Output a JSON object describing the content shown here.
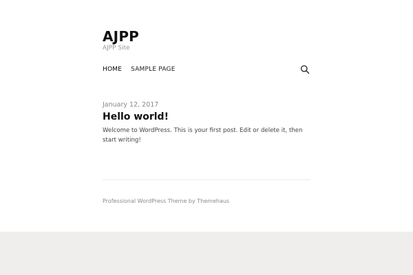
{
  "site": {
    "title": "AJPP",
    "description": "AJPP Site"
  },
  "nav": {
    "items": [
      {
        "label": "Home",
        "current": true
      },
      {
        "label": "Sample Page",
        "current": false
      }
    ],
    "search_icon": "search-icon"
  },
  "post": {
    "date": "January 12, 2017",
    "title": "Hello world!",
    "content": "Welcome to WordPress. This is your first post. Edit or delete it, then start writing!"
  },
  "footer": {
    "credit": "Professional WordPress Theme by Themehaus"
  },
  "colors": {
    "page_background": "#ffffff",
    "footer_background": "#efeeed",
    "text": "#111111",
    "muted": "#999999"
  }
}
